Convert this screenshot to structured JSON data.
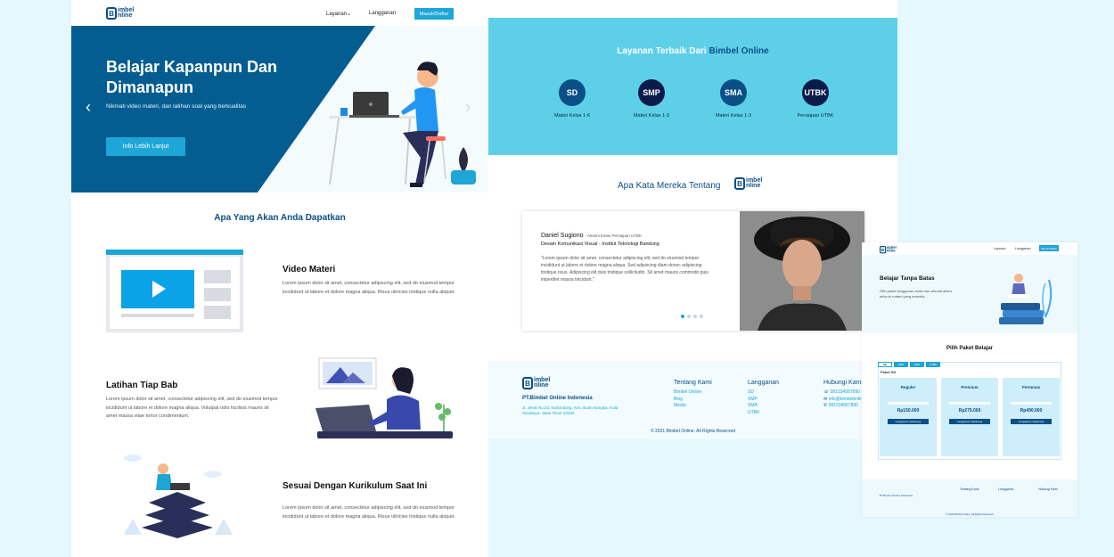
{
  "colors": {
    "navy": "#0a4f86",
    "accent": "#1da6d6",
    "cyan": "#5dd0e8",
    "bg": "#e4f8fd"
  },
  "brand": {
    "logo_mark": "B",
    "logo_text_1": "imbel",
    "logo_text_2": "nline"
  },
  "landing": {
    "nav": {
      "layanan": "Layanan",
      "langganan": "Langganan",
      "login": "Masuk/Daftar"
    },
    "hero": {
      "title": "Belajar Kapanpun Dan Dimanapun",
      "subtitle": "Nikmati video materi, dan latihan soal yang berkualitas",
      "cta": "Info Lebih Lanjut"
    },
    "section_title": "Apa Yang Akan Anda Dapatkan",
    "features": [
      {
        "title": "Video Materi",
        "text": "Lorem ipsum dolor sit amet, consectetur adipiscing elit, sed do eiusmod tempor incididunt ut labore et dolore magna aliqua. Risus ultricies tristique nulla aliquet."
      },
      {
        "title": "Latihan Tiap Bab",
        "text": "Lorem ipsum dolor sit amet, consectetur adipiscing elit, sed do eiusmod tempor incididunt ut labore et dolore magna aliqua. Volutpat odio facilisis mauris sit amet massa vitae tortor condimentum."
      },
      {
        "title": "Sesuai Dengan Kurikulum Saat Ini",
        "text": "Lorem ipsum dolor sit amet, consectetur adipiscing elit, sed do eiusmod tempor incididunt ut labore et dolore magna aliqua. Risus ultricies tristique nulla aliquet."
      }
    ]
  },
  "services": {
    "title_prefix": "Layanan Terbaik Dari ",
    "title_brand": "Bimbel Online",
    "items": [
      {
        "code": "SD",
        "caption": "Materi Kelas 1-6",
        "color": "#0a4f86"
      },
      {
        "code": "SMP",
        "caption": "Materi Kelas 1-3",
        "color": "#0a1a4a"
      },
      {
        "code": "SMA",
        "caption": "Materi Kelas 1-3",
        "color": "#0a4f86"
      },
      {
        "code": "UTBK",
        "caption": "Persiapan UTBK",
        "color": "#0a1a4a"
      }
    ]
  },
  "testimonial": {
    "title": "Apa Kata Mereka Tentang",
    "name": "Daniel Sugiono",
    "role": "- Alumni Kelas Persiapan UTBK",
    "dept": "Desain Komunikasi Visual - Institut Teknologi Bandung",
    "quote": "\"Lorem ipsum dolor sit amet, consectetur adipiscing elit, sed do eiusmod tempor incididunt ut labore et dolore magna aliqua. Sed adipiscing diam donec adipiscing tristique risus. Adipiscing elit duis tristique sollicitudin. Sit amet mauris commodo quis imperdiet massa tincidunt.\""
  },
  "footer": {
    "company": "PT.Bimbel Online Indonesia",
    "address": "Jl. Jeruk No.22, Kedondong, Kec. Buah Nangka, Kota Surabaya, Jawa Timur 22202",
    "about": {
      "title": "Tentang Kami",
      "items": [
        "Bimbel Online",
        "Blog",
        "Media"
      ]
    },
    "subs": {
      "title": "Langganan",
      "items": [
        "SD",
        "SMP",
        "SMA",
        "UTBK"
      ]
    },
    "contact": {
      "title": "Hubungi Kami",
      "phone": "081334567890",
      "email": "info@bimbelonline",
      "phone2": "081334567890"
    },
    "copyright": "© 2021 Bimbel Online. All Rights Reserved"
  },
  "pricing": {
    "nav": {
      "layanan": "Layanan",
      "langganan": "Langganan",
      "login": "Masuk/Daftar"
    },
    "hero_title": "Belajar Tanpa Batas",
    "hero_text": "Pilih paket langganan anda dan nikmati akses seluruh materi yang tersedia",
    "section_title": "Pilih Paket Belajar",
    "tabs": [
      "SD",
      "SMP",
      "SMA",
      "UTBK"
    ],
    "group": "Paket SD",
    "plans": [
      {
        "name": "Reguler",
        "price": "Rp150.000",
        "button": "Langganan Sekarang"
      },
      {
        "name": "Premium",
        "price": "Rp275.000",
        "button": "Langganan Sekarang"
      },
      {
        "name": "Pertamax",
        "price": "Rp490.000",
        "button": "Langganan Sekarang"
      }
    ],
    "footer_company": "PT.Bimbel Online Indonesia",
    "footer_about": "Tentang Kami",
    "footer_subs": "Langganan",
    "footer_contact": "Hubungi Kami",
    "footer_copy": "© 2021 Bimbel Online. All Rights Reserved"
  }
}
